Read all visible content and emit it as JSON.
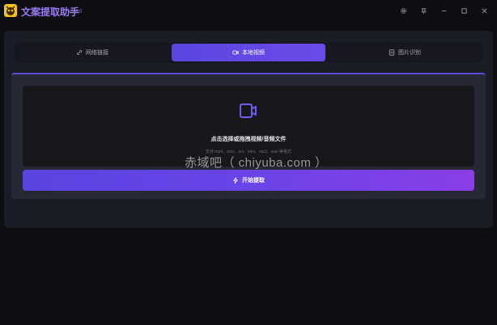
{
  "app": {
    "title": "文案提取助手",
    "version": "v1.0.0"
  },
  "window_controls": [
    "gear-icon",
    "pin-icon",
    "minimize-icon",
    "maximize-icon",
    "close-icon"
  ],
  "tabs": [
    {
      "label": "网络链接",
      "icon": "link-icon",
      "active": false
    },
    {
      "label": "本地视频",
      "icon": "video-icon",
      "active": true
    },
    {
      "label": "图片识别",
      "icon": "image-icon",
      "active": false
    }
  ],
  "dropzone": {
    "title": "点击选择或拖拽视频/音频文件",
    "hint": "支持 mp4、mov、avi、mkv、mp3、wav 等格式"
  },
  "start_button": {
    "label": "开始提取"
  },
  "watermark": "赤域吧（ chiyuba.com ）",
  "colors": {
    "accent": "#6b4ae8",
    "background": "#0d0d12",
    "card": "#1b1d26"
  }
}
